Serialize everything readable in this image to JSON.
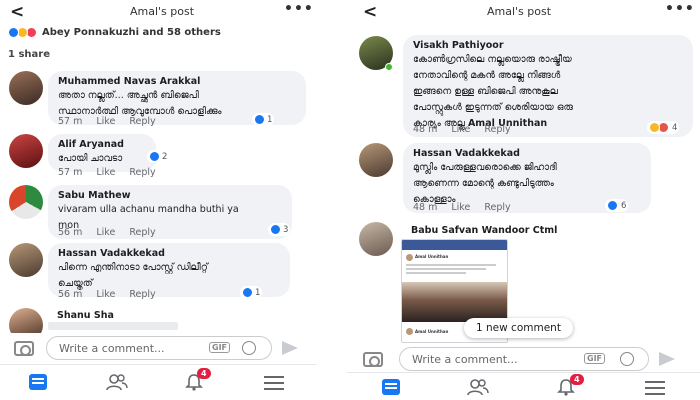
{
  "left": {
    "header": {
      "back": "<",
      "title": "Amal's post",
      "menu": "•••"
    },
    "reactions": {
      "text": "Abey Ponnakuzhi and 58 others"
    },
    "shares": "1 share",
    "comments": [
      {
        "name": "Muhammed Navas Arakkal",
        "lines": [
          "അതാ നല്ലത്... അച്ഛൻ ബിജെപി",
          "സ്ഥാനാർത്ഥി ആവുമ്പോൾ പൊളിക്കും"
        ],
        "time": "57 m",
        "like": "Like",
        "reply": "Reply",
        "count": "1"
      },
      {
        "name": "Alif Aryanad",
        "lines": [
          "പോയി ചാവടാ"
        ],
        "time": "57 m",
        "like": "Like",
        "reply": "Reply",
        "count": "2"
      },
      {
        "name": "Sabu Mathew",
        "lines": [
          "vivaram ulla achanu mandha buthi ya",
          "mon"
        ],
        "time": "56 m",
        "like": "Like",
        "reply": "Reply",
        "count": "3"
      },
      {
        "name": "Hassan Vadakkekad",
        "lines": [
          "പിന്നെ എന്തിനാടാ പോസ്റ്റ് ഡിലീറ്റ്",
          "ചെയ്തത്"
        ],
        "time": "56 m",
        "like": "Like",
        "reply": "Reply",
        "count": "1"
      },
      {
        "name": "Shanu Sha",
        "lines": [],
        "time": "",
        "like": "",
        "reply": "",
        "count": ""
      }
    ],
    "input": {
      "placeholder": "Write a comment...",
      "gif": "GIF"
    },
    "nav": {
      "badge": "4"
    }
  },
  "right": {
    "header": {
      "back": "<",
      "title": "Amal's post",
      "menu": "•••"
    },
    "comments": [
      {
        "name": "Visakh Pathiyoor",
        "lines": [
          "കോൺഗ്രസിലെ നല്ലയൊരു രാഷ്ട്രീയ",
          "നേതാവിന്റെ മകൻ അല്ലേ നിങ്ങൾ",
          "ഇങ്ങനെ ഉള്ള ബിജെപി അനുകൂല",
          "പോസ്റ്റുകൾ ഇടുന്നത് ശെരിയായ ഒരു",
          "കാര്യം അല്ല"
        ],
        "mention": "Amal Unnithan",
        "time": "48 m",
        "like": "Like",
        "reply": "Reply",
        "count": "4"
      },
      {
        "name": "Hassan Vadakkekad",
        "lines": [
          "മുസ്ലിം പേരുള്ളവരൊക്കെ ജിഹാദി",
          "ആണെന്ന മോന്റെ കണ്ടുപിടുത്തം",
          "കൊള്ളാം"
        ],
        "time": "48 m",
        "like": "Like",
        "reply": "Reply",
        "count": "6"
      },
      {
        "name": "Babu Safvan Wandoor Ctml"
      }
    ],
    "shared_post": {
      "author": "Amal Unnithan",
      "second_author": "Amal Unnithan"
    },
    "new_comment": "1 new comment",
    "input": {
      "placeholder": "Write a comment...",
      "gif": "GIF"
    },
    "nav": {
      "badge": "4"
    }
  },
  "colors": {
    "accent": "#1877f2",
    "badge": "#e41e3f",
    "bubble": "#f0f2f5",
    "meta": "#65676b"
  }
}
